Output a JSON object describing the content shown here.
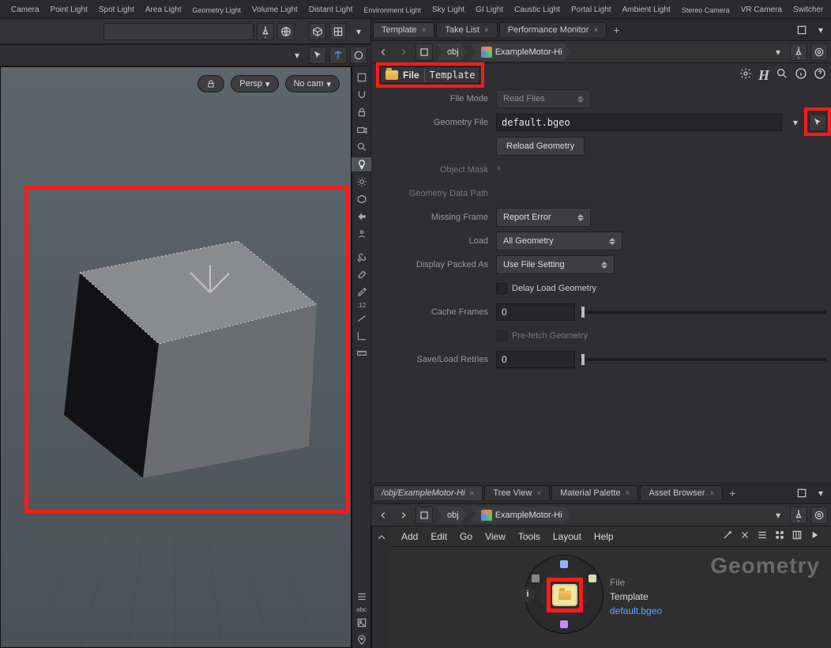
{
  "shelf": [
    "Camera",
    "Point Light",
    "Spot Light",
    "Area Light",
    "Geometry Light",
    "Volume Light",
    "Distant Light",
    "Environment Light",
    "Sky Light",
    "GI Light",
    "Caustic Light",
    "Portal Light",
    "Ambient Light",
    "Stereo Camera",
    "VR Camera",
    "Switcher"
  ],
  "tabs": {
    "top": [
      "Template",
      "Take List",
      "Performance Monitor"
    ],
    "bottom": [
      "/obj/ExampleMotor-Hi",
      "Tree View",
      "Material Palette",
      "Asset Browser"
    ]
  },
  "breadcrumb": {
    "level1": "obj",
    "level2": "ExampleMotor-Hi"
  },
  "viewport": {
    "lock": "🔒",
    "cam1": "Persp",
    "cam2": "No cam"
  },
  "node_header": {
    "type": "File",
    "name": "Template"
  },
  "params": {
    "file_mode": {
      "label": "File Mode",
      "value": "Read Files"
    },
    "geo_file": {
      "label": "Geometry File",
      "value": "default.bgeo"
    },
    "reload": {
      "label": "Reload Geometry"
    },
    "obj_mask": {
      "label": "Object Mask",
      "value": "*"
    },
    "geo_path": {
      "label": "Geometry Data Path",
      "value": ""
    },
    "miss_frame": {
      "label": "Missing Frame",
      "value": "Report Error"
    },
    "load": {
      "label": "Load",
      "value": "All Geometry"
    },
    "packed": {
      "label": "Display Packed As",
      "value": "Use File Setting"
    },
    "delay": {
      "label": "Delay Load Geometry"
    },
    "cache": {
      "label": "Cache Frames",
      "value": "0"
    },
    "prefetch": {
      "label": "Pre-fetch Geometry"
    },
    "retries": {
      "label": "Save/Load Retries",
      "value": "0"
    }
  },
  "menus": [
    "Add",
    "Edit",
    "Go",
    "View",
    "Tools",
    "Layout",
    "Help"
  ],
  "network": {
    "context_label": "Geometry",
    "node_type": "File",
    "node_name": "Template",
    "node_file": "default.bgeo"
  }
}
